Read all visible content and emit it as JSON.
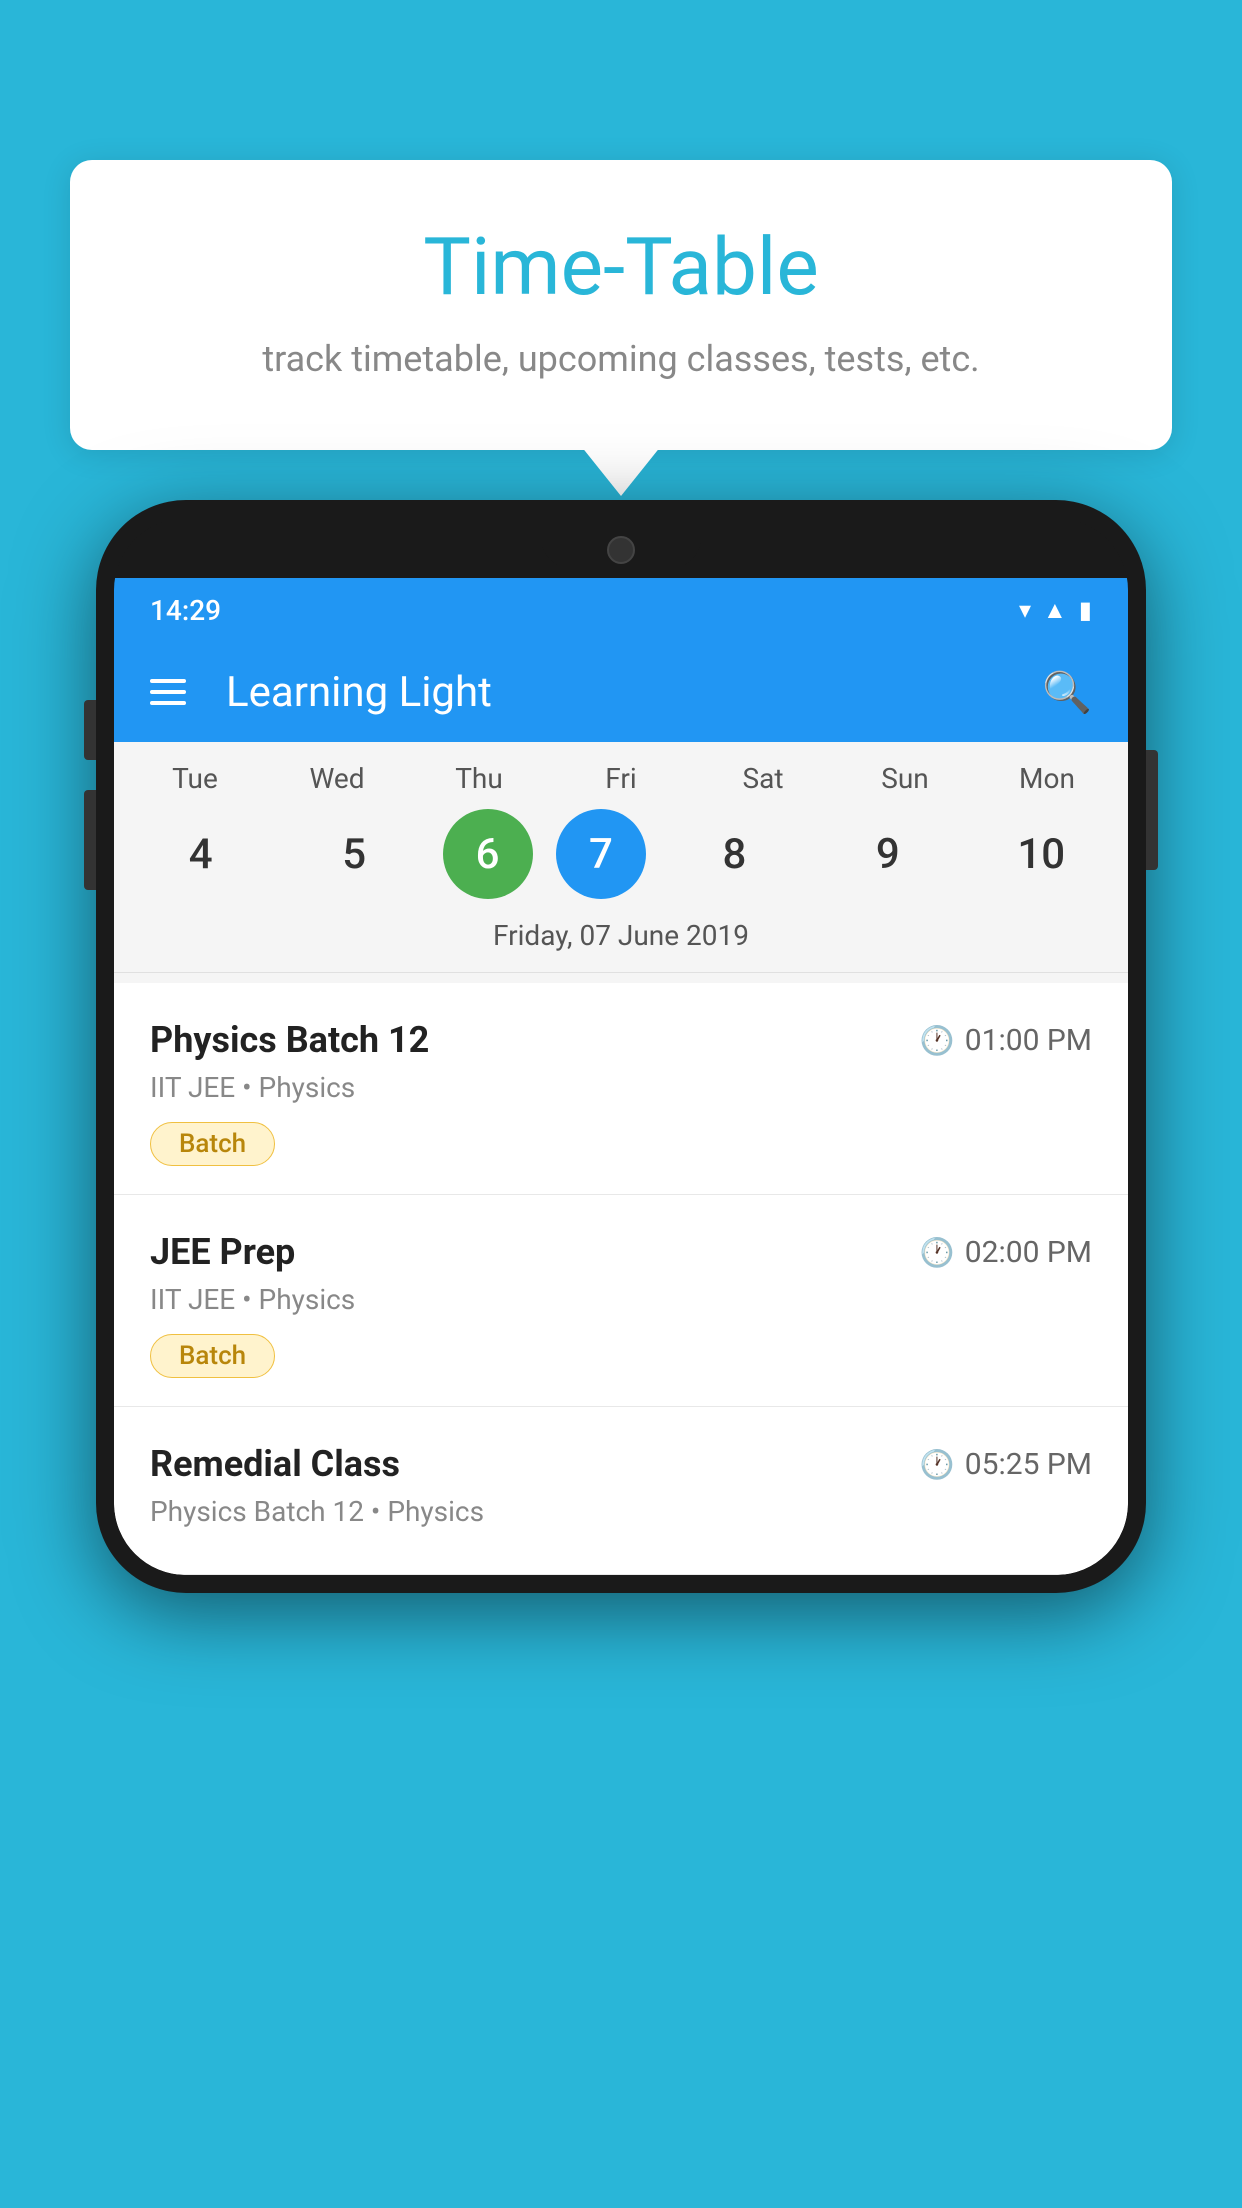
{
  "background_color": "#29b6d8",
  "tooltip": {
    "title": "Time-Table",
    "subtitle": "track timetable, upcoming classes, tests, etc."
  },
  "app": {
    "name": "Learning Light",
    "status_time": "14:29"
  },
  "calendar": {
    "days": [
      {
        "name": "Tue",
        "num": "4",
        "state": "normal"
      },
      {
        "name": "Wed",
        "num": "5",
        "state": "normal"
      },
      {
        "name": "Thu",
        "num": "6",
        "state": "today"
      },
      {
        "name": "Fri",
        "num": "7",
        "state": "selected"
      },
      {
        "name": "Sat",
        "num": "8",
        "state": "normal"
      },
      {
        "name": "Sun",
        "num": "9",
        "state": "normal"
      },
      {
        "name": "Mon",
        "num": "10",
        "state": "normal"
      }
    ],
    "selected_date_label": "Friday, 07 June 2019"
  },
  "schedule_items": [
    {
      "title": "Physics Batch 12",
      "time": "01:00 PM",
      "subtitle": "IIT JEE • Physics",
      "badge": "Batch"
    },
    {
      "title": "JEE Prep",
      "time": "02:00 PM",
      "subtitle": "IIT JEE • Physics",
      "badge": "Batch"
    },
    {
      "title": "Remedial Class",
      "time": "05:25 PM",
      "subtitle": "Physics Batch 12 • Physics",
      "badge": null
    }
  ]
}
